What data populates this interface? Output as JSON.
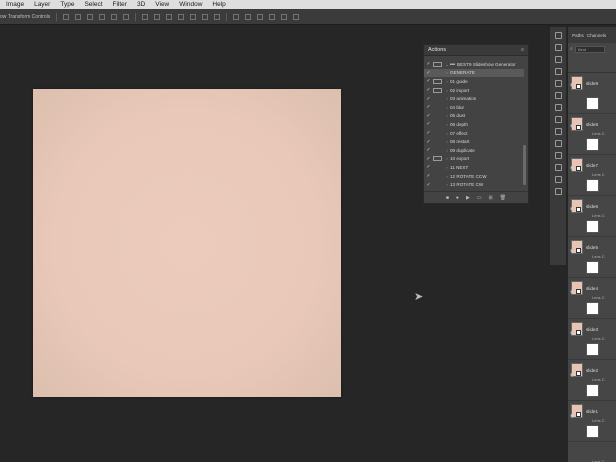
{
  "menu": [
    "Image",
    "Layer",
    "Type",
    "Select",
    "Filter",
    "3D",
    "View",
    "Window",
    "Help"
  ],
  "options_bar": {
    "label": "ow Transform Controls"
  },
  "actions_panel": {
    "title": "Actions",
    "menu_icon": "panel-menu-icon",
    "rows": [
      {
        "label": "BEST9 Slideshow Generator",
        "check": "✓",
        "dialog": true,
        "expander": "⌄",
        "folder": true,
        "selected": false
      },
      {
        "label": "GENERATE",
        "check": "✓",
        "dialog": false,
        "expander": "›",
        "folder": false,
        "selected": true
      },
      {
        "label": "01 guide",
        "check": "✓",
        "dialog": true,
        "expander": "›",
        "folder": false,
        "selected": false
      },
      {
        "label": "02 import",
        "check": "✓",
        "dialog": true,
        "expander": "›",
        "folder": false,
        "selected": false
      },
      {
        "label": "03 animation",
        "check": "✓",
        "dialog": false,
        "expander": "›",
        "folder": false,
        "selected": false
      },
      {
        "label": "04 blur",
        "check": "✓",
        "dialog": false,
        "expander": "›",
        "folder": false,
        "selected": false
      },
      {
        "label": "05 dust",
        "check": "✓",
        "dialog": false,
        "expander": "›",
        "folder": false,
        "selected": false
      },
      {
        "label": "06 depth",
        "check": "✓",
        "dialog": false,
        "expander": "›",
        "folder": false,
        "selected": false
      },
      {
        "label": "07 effect",
        "check": "✓",
        "dialog": false,
        "expander": "›",
        "folder": false,
        "selected": false
      },
      {
        "label": "08 restart",
        "check": "✓",
        "dialog": false,
        "expander": "›",
        "folder": false,
        "selected": false
      },
      {
        "label": "09 duplicate",
        "check": "✓",
        "dialog": false,
        "expander": "›",
        "folder": false,
        "selected": false
      },
      {
        "label": "10 export",
        "check": "✓",
        "dialog": true,
        "expander": "›",
        "folder": false,
        "selected": false
      },
      {
        "label": "11 NEXT",
        "check": "✓",
        "dialog": false,
        "expander": "›",
        "folder": false,
        "selected": false
      },
      {
        "label": "12 ROTATE CCW",
        "check": "✓",
        "dialog": false,
        "expander": "›",
        "folder": false,
        "selected": false
      },
      {
        "label": "13 ROTATE CW",
        "check": "✓",
        "dialog": false,
        "expander": "›",
        "folder": false,
        "selected": false
      }
    ],
    "footer_icons": [
      "stop-icon",
      "record-icon",
      "play-icon",
      "new-set-icon",
      "new-action-icon",
      "delete-icon"
    ]
  },
  "layers_panel": {
    "tabs": [
      "Paths",
      "Channels"
    ],
    "filter": "Kind",
    "layers": [
      {
        "name": "slide9",
        "sub": "Lens C"
      },
      {
        "name": "slide8",
        "sub": "Lens C"
      },
      {
        "name": "slide7",
        "sub": "Lens C"
      },
      {
        "name": "slide6",
        "sub": "Lens C"
      },
      {
        "name": "slide5",
        "sub": "Lens C"
      },
      {
        "name": "slide4",
        "sub": "Lens C"
      },
      {
        "name": "slide3",
        "sub": "Lens C"
      },
      {
        "name": "slide2",
        "sub": "Lens C"
      },
      {
        "name": "slide1",
        "sub": "Lens C"
      }
    ]
  },
  "colors": {
    "canvas": "#e9c8b9",
    "background": "#262626",
    "panel": "#434343"
  }
}
